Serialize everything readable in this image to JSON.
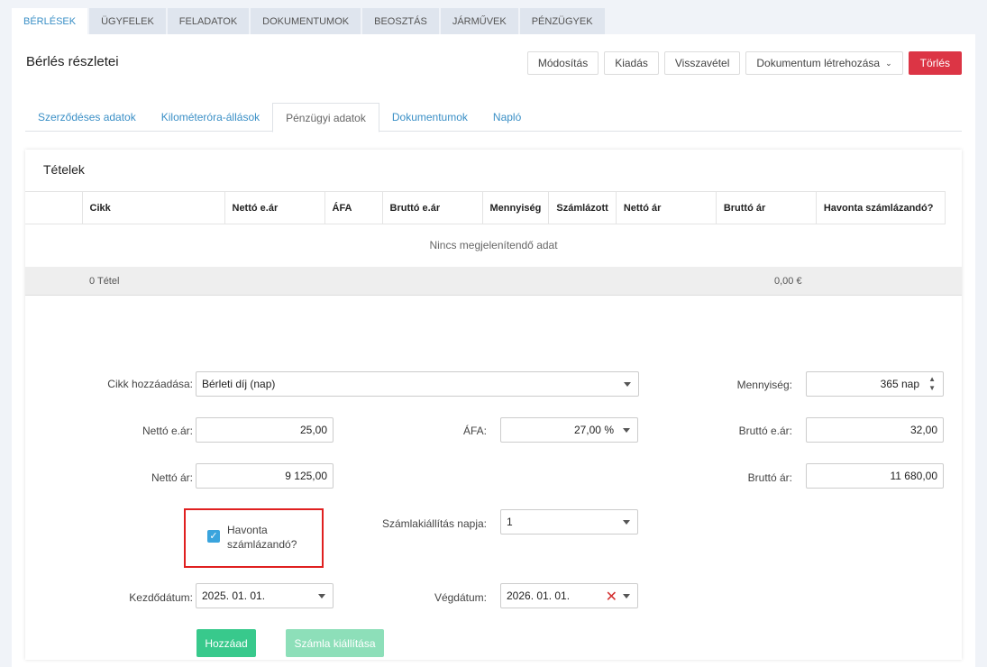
{
  "top_tabs": [
    "BÉRLÉSEK",
    "ÜGYFELEK",
    "FELADATOK",
    "DOKUMENTUMOK",
    "BEOSZTÁS",
    "JÁRMŰVEK",
    "PÉNZÜGYEK"
  ],
  "page_title": "Bérlés részletei",
  "actions": {
    "modify": "Módosítás",
    "issue": "Kiadás",
    "return": "Visszavétel",
    "create_document": "Dokumentum létrehozása",
    "delete": "Törlés"
  },
  "sub_tabs": [
    "Szerződéses adatok",
    "Kilométeróra-állások",
    "Pénzügyi adatok",
    "Dokumentumok",
    "Napló"
  ],
  "items_panel": {
    "title": "Tételek",
    "columns": [
      "",
      "Cikk",
      "Nettó e.ár",
      "ÁFA",
      "Bruttó e.ár",
      "Mennyiség",
      "Számlázott",
      "Nettó ár",
      "Bruttó ár",
      "Havonta számlázandó?"
    ],
    "empty_text": "Nincs megjelenítendő adat",
    "footer_count": "0 Tétel",
    "footer_total": "0,00 €"
  },
  "form": {
    "item_label": "Cikk hozzáadása:",
    "item_value": "Bérleti díj (nap)",
    "quantity_label": "Mennyiség:",
    "quantity_value": "365 nap",
    "net_unit_label": "Nettó e.ár:",
    "net_unit_value": "25,00",
    "vat_label": "ÁFA:",
    "vat_value": "27,00 %",
    "gross_unit_label": "Bruttó e.ár:",
    "gross_unit_value": "32,00",
    "net_price_label": "Nettó ár:",
    "net_price_value": "9 125,00",
    "gross_price_label": "Bruttó ár:",
    "gross_price_value": "11 680,00",
    "monthly_label": "Havonta számlázandó?",
    "monthly_checked": true,
    "invoice_day_label": "Számlakiállítás napja:",
    "invoice_day_value": "1",
    "start_label": "Kezdődátum:",
    "start_value": "2025. 01. 01.",
    "end_label": "Végdátum:",
    "end_value": "2026. 01. 01.",
    "add_button": "Hozzáad",
    "invoice_button": "Számla kiállítása"
  },
  "colors": {
    "accent": "#3a8fc6",
    "danger": "#dc3545",
    "green": "#38c98c",
    "green_disabled": "#8ddfb9",
    "highlight": "#e02020"
  }
}
